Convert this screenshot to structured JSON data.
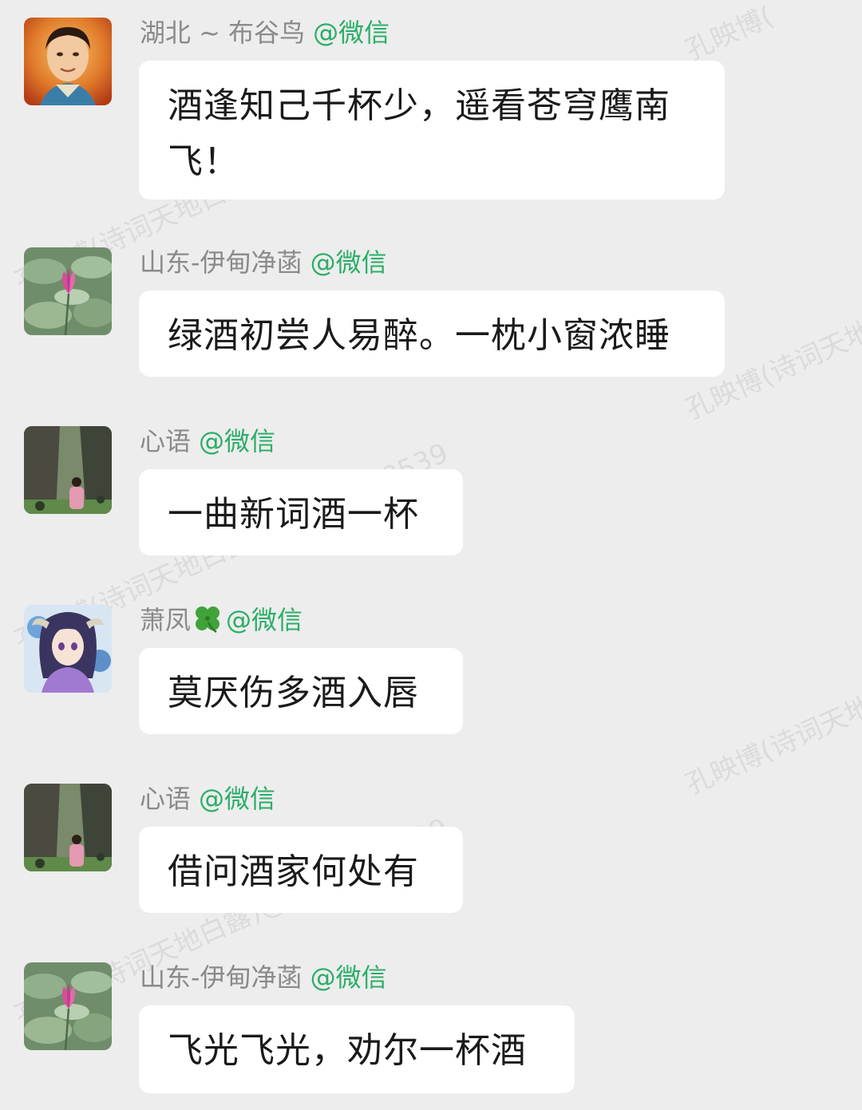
{
  "messages": [
    {
      "sender": "湖北 ~ 布谷鸟",
      "source": "@微信",
      "text": "酒逢知己千杯少，遥看苍穹鹰南飞！",
      "avatar": "portrait-avatar"
    },
    {
      "sender": "山东-伊甸净菡",
      "source": "@微信",
      "text": "绿酒初尝人易醉。一枕小窗浓睡",
      "avatar": "lotus-avatar"
    },
    {
      "sender": "心语",
      "source": "@微信",
      "text": "一曲新词酒一杯",
      "avatar": "cliff-avatar"
    },
    {
      "sender": "萧凤",
      "source": "@微信",
      "text": "莫厌伤多酒入唇",
      "avatar": "anime-avatar",
      "emoji": "four-leaf-clover"
    },
    {
      "sender": "心语",
      "source": "@微信",
      "text": "借问酒家何处有",
      "avatar": "cliff-avatar"
    },
    {
      "sender": "山东-伊甸净菡",
      "source": "@微信",
      "text": "飞光飞光，劝尔一杯酒",
      "avatar": "lotus-avatar"
    }
  ],
  "watermark": {
    "lines": [
      "孔映博(诗词天地白露)@诗词天地8539"
    ]
  },
  "colors": {
    "background": "#ededed",
    "bubble": "#ffffff",
    "source_green": "#2aae67",
    "sender_gray": "#8a8a8a"
  }
}
